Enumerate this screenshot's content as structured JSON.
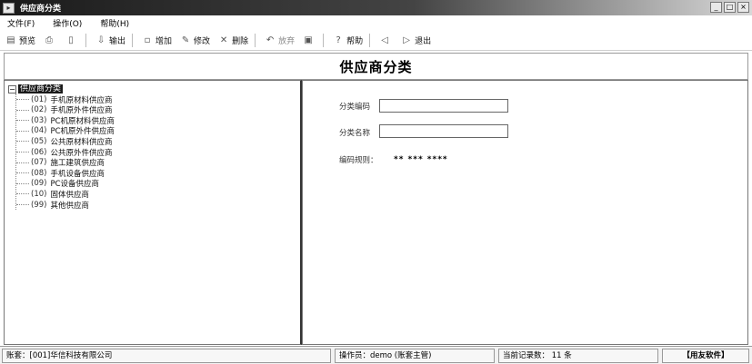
{
  "window": {
    "title": "供应商分类",
    "controls": [
      "_",
      "□",
      "×"
    ]
  },
  "menu": [
    "文件(F)",
    "操作(O)",
    "帮助(H)"
  ],
  "toolbar": [
    {
      "icon": "preview-icon",
      "glyph": "▤",
      "label": "预览",
      "disabled": false
    },
    {
      "icon": "print-icon",
      "glyph": "⎙",
      "label": "",
      "disabled": true
    },
    {
      "icon": "page-icon",
      "glyph": "▯",
      "label": "",
      "disabled": true
    },
    {
      "icon": "export-icon",
      "glyph": "⇩",
      "label": "输出",
      "disabled": false
    },
    {
      "icon": "add-icon",
      "glyph": "▫",
      "label": "增加",
      "disabled": false
    },
    {
      "icon": "edit-icon",
      "glyph": "✎",
      "label": "修改",
      "disabled": false
    },
    {
      "icon": "delete-icon",
      "glyph": "✕",
      "label": "删除",
      "disabled": false
    },
    {
      "icon": "undo-icon",
      "glyph": "↶",
      "label": "放弃",
      "disabled": true
    },
    {
      "icon": "save-icon",
      "glyph": "▣",
      "label": "",
      "disabled": true
    },
    {
      "icon": "help-icon",
      "glyph": "?",
      "label": "帮助",
      "disabled": false
    },
    {
      "icon": "prev-icon",
      "glyph": "◁",
      "label": "",
      "disabled": true
    },
    {
      "icon": "exit-icon",
      "glyph": "▷",
      "label": "退出",
      "disabled": false
    }
  ],
  "page_title": "供应商分类",
  "tree": {
    "root": "供应商分类",
    "items": [
      {
        "code": "(01)",
        "name": "手机原材料供应商"
      },
      {
        "code": "(02)",
        "name": "手机原外件供应商"
      },
      {
        "code": "(03)",
        "name": "PC机原材料供应商"
      },
      {
        "code": "(04)",
        "name": "PC机原外件供应商"
      },
      {
        "code": "(05)",
        "name": "公共原材料供应商"
      },
      {
        "code": "(06)",
        "name": "公共原外件供应商"
      },
      {
        "code": "(07)",
        "name": "施工建筑供应商"
      },
      {
        "code": "(08)",
        "name": "手机设备供应商"
      },
      {
        "code": "(09)",
        "name": "PC设备供应商"
      },
      {
        "code": "(10)",
        "name": "固体供应商"
      },
      {
        "code": "(99)",
        "name": "其他供应商"
      }
    ]
  },
  "form": {
    "code_label": "分类编码",
    "code_value": "",
    "name_label": "分类名称",
    "name_value": "",
    "rule_label": "编码规则：",
    "rule_value": "** *** ****"
  },
  "status": {
    "account": "账套：[001]华信科技有限公司",
    "operator": "操作员：demo (账套主管)",
    "records": "当前记录数：  11 条",
    "brand": "【用友软件】"
  }
}
